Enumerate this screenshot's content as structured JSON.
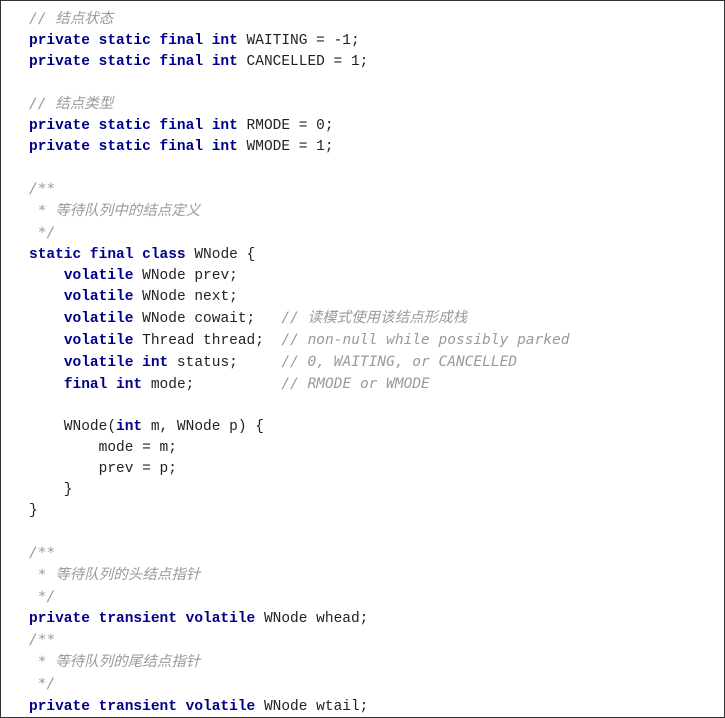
{
  "code": {
    "c1": "// 结点状态",
    "l2": {
      "kw": "private static final int",
      "id": " WAITING = ",
      "val": "-1",
      "end": ";"
    },
    "l3": {
      "kw": "private static final int",
      "id": " CANCELLED = ",
      "val": "1",
      "end": ";"
    },
    "c4": "// 结点类型",
    "l5": {
      "kw": "private static final int",
      "id": " RMODE = ",
      "val": "0",
      "end": ";"
    },
    "l6": {
      "kw": "private static final int",
      "id": " WMODE = ",
      "val": "1",
      "end": ";"
    },
    "doc1a": "/**",
    "doc1b": " * 等待队列中的结点定义",
    "doc1c": " */",
    "l7": {
      "kw1": "static final class",
      "name": " WNode {"
    },
    "l8": {
      "kw": "volatile",
      "rest": " WNode prev;"
    },
    "l9": {
      "kw": "volatile",
      "rest": " WNode next;"
    },
    "l10": {
      "kw": "volatile",
      "rest": " WNode cowait;   ",
      "cm": "// 读模式使用该结点形成栈"
    },
    "l11": {
      "kw": "volatile",
      "rest": " Thread thread;  ",
      "cm": "// non-null while possibly parked"
    },
    "l12": {
      "kw": "volatile int",
      "rest": " status;     ",
      "cm": "// 0, WAITING, or CANCELLED"
    },
    "l13": {
      "kw": "final int",
      "rest": " mode;          ",
      "cm": "// RMODE or WMODE"
    },
    "l14a": "    WNode(",
    "l14kw": "int",
    "l14b": " m, WNode p) {",
    "l15": "        mode = m;",
    "l16": "        prev = p;",
    "l17": "    }",
    "l18": "}",
    "doc2a": "/**",
    "doc2b": " * 等待队列的头结点指针",
    "doc2c": " */",
    "l19": {
      "kw": "private transient volatile",
      "rest": " WNode whead;"
    },
    "doc3a": "/**",
    "doc3b": " * 等待队列的尾结点指针",
    "doc3c": " */",
    "l20": {
      "kw": "private transient volatile",
      "rest": " WNode wtail;"
    }
  }
}
